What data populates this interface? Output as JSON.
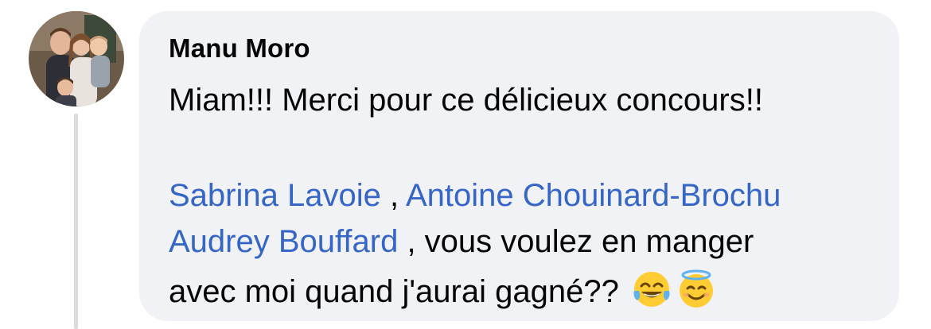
{
  "comment": {
    "author": "Manu Moro",
    "text_line1": "Miam!!! Merci pour ce délicieux concours!!",
    "mentions": [
      "Sabrina Lavoie",
      "Antoine Chouinard-Brochu",
      "Audrey Bouffard"
    ],
    "separator": " , ",
    "text_after_mentions": " , vous voulez en manger",
    "text_line4": "avec moi quand j'aurai gagné?? ",
    "emojis": [
      "tears-of-joy-emoji",
      "smiling-face-with-halo-emoji"
    ]
  },
  "colors": {
    "bubble": "#f0f2f5",
    "mention": "#3565c6",
    "text": "#050505",
    "thread_line": "#d9dbe0"
  }
}
